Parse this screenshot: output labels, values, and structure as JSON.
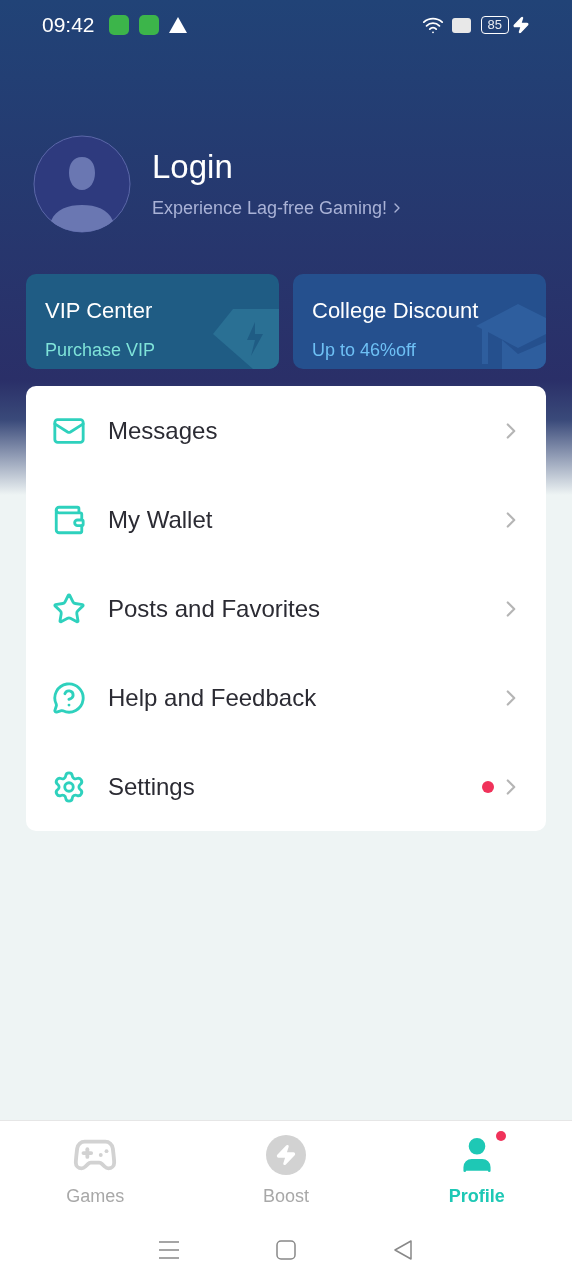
{
  "status_bar": {
    "time": "09:42",
    "battery": "85",
    "charging": true
  },
  "profile": {
    "title": "Login",
    "subtitle": "Experience Lag-free Gaming!"
  },
  "promo_cards": [
    {
      "kind": "vip",
      "title": "VIP Center",
      "subtitle": "Purchase VIP"
    },
    {
      "kind": "college",
      "title": "College Discount",
      "subtitle": "Up to 46%off"
    }
  ],
  "menu": [
    {
      "kind": "messages",
      "label": "Messages",
      "badge": false
    },
    {
      "kind": "wallet",
      "label": "My Wallet",
      "badge": false
    },
    {
      "kind": "posts",
      "label": "Posts and Favorites",
      "badge": false
    },
    {
      "kind": "help",
      "label": "Help and Feedback",
      "badge": false
    },
    {
      "kind": "settings",
      "label": "Settings",
      "badge": true
    }
  ],
  "tabs": [
    {
      "kind": "games",
      "label": "Games",
      "selected": false,
      "badge": false
    },
    {
      "kind": "boost",
      "label": "Boost",
      "selected": false,
      "badge": false
    },
    {
      "kind": "profile",
      "label": "Profile",
      "selected": true,
      "badge": true
    }
  ]
}
